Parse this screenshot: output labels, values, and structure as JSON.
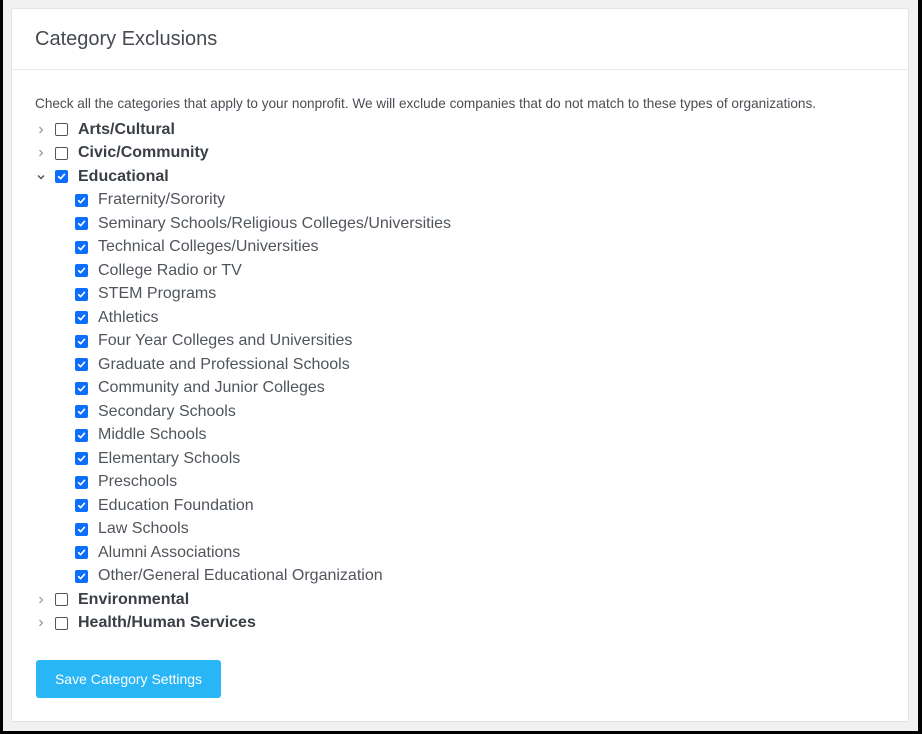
{
  "header": {
    "title": "Category Exclusions"
  },
  "instructions": "Check all the categories that apply to your nonprofit. We will exclude companies that do not match to these types of organizations.",
  "categories": [
    {
      "label": "Arts/Cultural",
      "checked": false,
      "expanded": false,
      "children": []
    },
    {
      "label": "Civic/Community",
      "checked": false,
      "expanded": false,
      "children": []
    },
    {
      "label": "Educational",
      "checked": true,
      "expanded": true,
      "children": [
        {
          "label": "Fraternity/Sorority",
          "checked": true
        },
        {
          "label": "Seminary Schools/Religious Colleges/Universities",
          "checked": true
        },
        {
          "label": "Technical Colleges/Universities",
          "checked": true
        },
        {
          "label": "College Radio or TV",
          "checked": true
        },
        {
          "label": "STEM Programs",
          "checked": true
        },
        {
          "label": "Athletics",
          "checked": true
        },
        {
          "label": "Four Year Colleges and Universities",
          "checked": true
        },
        {
          "label": "Graduate and Professional Schools",
          "checked": true
        },
        {
          "label": "Community and Junior Colleges",
          "checked": true
        },
        {
          "label": "Secondary Schools",
          "checked": true
        },
        {
          "label": "Middle Schools",
          "checked": true
        },
        {
          "label": "Elementary Schools",
          "checked": true
        },
        {
          "label": "Preschools",
          "checked": true
        },
        {
          "label": "Education Foundation",
          "checked": true
        },
        {
          "label": "Law Schools",
          "checked": true
        },
        {
          "label": "Alumni Associations",
          "checked": true
        },
        {
          "label": "Other/General Educational Organization",
          "checked": true
        }
      ]
    },
    {
      "label": "Environmental",
      "checked": false,
      "expanded": false,
      "children": []
    },
    {
      "label": "Health/Human Services",
      "checked": false,
      "expanded": false,
      "children": []
    }
  ],
  "save_button": {
    "label": "Save Category Settings"
  },
  "colors": {
    "checkbox_checked": "#0b6efd",
    "button": "#29b6f6"
  }
}
